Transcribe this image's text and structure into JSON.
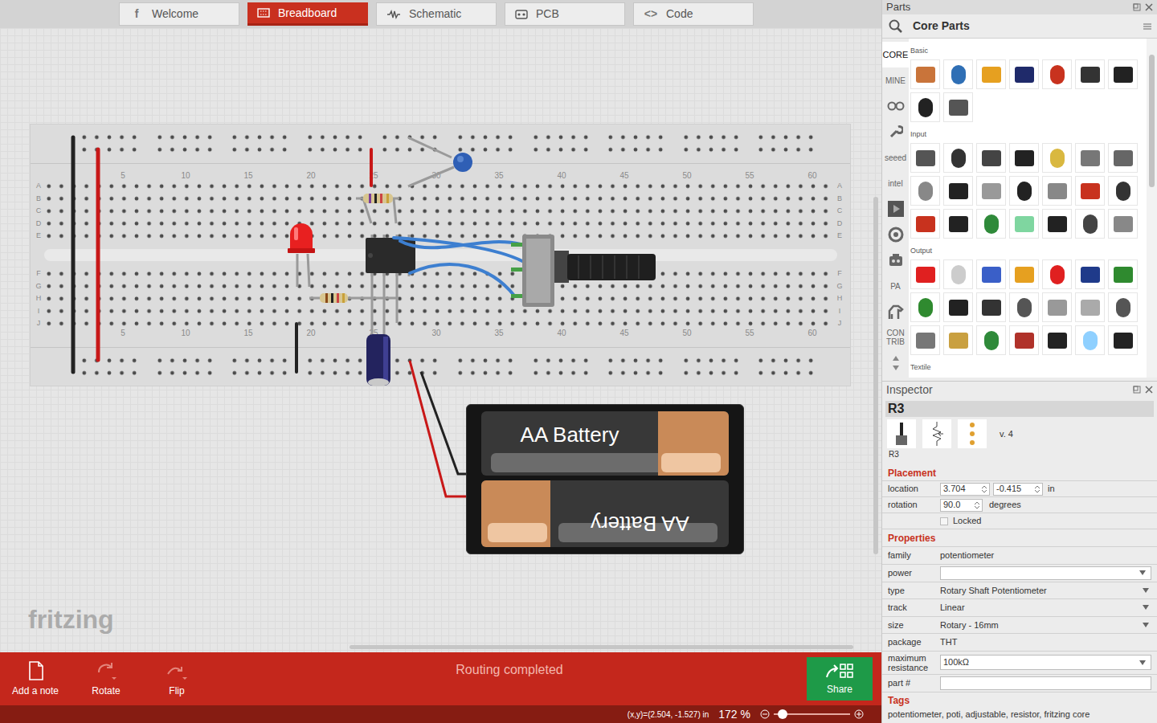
{
  "tabs": [
    {
      "label": "Welcome",
      "icon": "f",
      "selected": false
    },
    {
      "label": "Breadboard",
      "selected": true
    },
    {
      "label": "Schematic",
      "selected": false
    },
    {
      "label": "PCB",
      "selected": false
    },
    {
      "label": "Code",
      "icon": "<>",
      "selected": false
    }
  ],
  "canvas": {
    "watermark": "fritzing",
    "breadboard": {
      "column_labels": [
        "5",
        "10",
        "15",
        "20",
        "25",
        "30",
        "35",
        "40",
        "45",
        "50",
        "55",
        "60"
      ],
      "row_labels": [
        "A",
        "B",
        "C",
        "D",
        "E",
        "F",
        "G",
        "H",
        "I",
        "J"
      ]
    },
    "battery": {
      "labels": [
        "AA Battery",
        "AA Battery"
      ]
    }
  },
  "toolbar": {
    "buttons": [
      {
        "label": "Add a note",
        "disabled": false
      },
      {
        "label": "Rotate",
        "disabled": true
      },
      {
        "label": "Flip",
        "disabled": true
      }
    ],
    "status": "Routing completed",
    "share": "Share"
  },
  "status_bar": {
    "coordinates": "(x,y)=(2.504, -1.527) in",
    "zoom": "172 %",
    "zoom_level": 0.12
  },
  "parts": {
    "title": "Parts",
    "bin_title": "Core Parts",
    "bins": [
      {
        "kind": "text",
        "label": "CORE",
        "selected": true
      },
      {
        "kind": "text",
        "label": "MINE",
        "selected": false
      },
      {
        "kind": "icon",
        "selected": false
      },
      {
        "kind": "icon",
        "selected": false
      },
      {
        "kind": "text",
        "label": "seeed",
        "selected": false
      },
      {
        "kind": "text",
        "label": "intel",
        "selected": false
      },
      {
        "kind": "icon",
        "selected": false
      },
      {
        "kind": "icon",
        "selected": false
      },
      {
        "kind": "icon",
        "selected": false
      },
      {
        "kind": "text",
        "label": "PA",
        "selected": false
      },
      {
        "kind": "icon",
        "selected": false
      },
      {
        "kind": "text",
        "label": "CON TRIB",
        "selected": false
      }
    ],
    "sections": [
      {
        "label": "Basic"
      },
      {
        "label": "Input"
      },
      {
        "label": "Output"
      },
      {
        "label": "Textile"
      }
    ]
  },
  "inspector": {
    "title": "Inspector",
    "part": "R3",
    "version": "v. 4",
    "caption": "R3",
    "placement": {
      "heading": "Placement",
      "location_label": "location",
      "x": "3.704",
      "y": "-0.415",
      "unit": "in",
      "rotation_label": "rotation",
      "rotation": "90.0",
      "rotation_unit": "degrees",
      "locked_label": "Locked",
      "locked": false
    },
    "properties": {
      "heading": "Properties",
      "rows": [
        {
          "label": "family",
          "value": "potentiometer",
          "kind": "text"
        },
        {
          "label": "power",
          "value": "",
          "kind": "combo"
        },
        {
          "label": "type",
          "value": "Rotary Shaft Potentiometer",
          "kind": "select"
        },
        {
          "label": "track",
          "value": "Linear",
          "kind": "select"
        },
        {
          "label": "size",
          "value": "Rotary - 16mm",
          "kind": "select"
        },
        {
          "label": "package",
          "value": "THT",
          "kind": "text"
        },
        {
          "label": "maximum resistance",
          "value": "100kΩ",
          "kind": "combo"
        },
        {
          "label": "part #",
          "value": "",
          "kind": "input"
        }
      ]
    },
    "tags": {
      "heading": "Tags",
      "value": "potentiometer, poti, adjustable, resistor, fritzing core"
    }
  }
}
